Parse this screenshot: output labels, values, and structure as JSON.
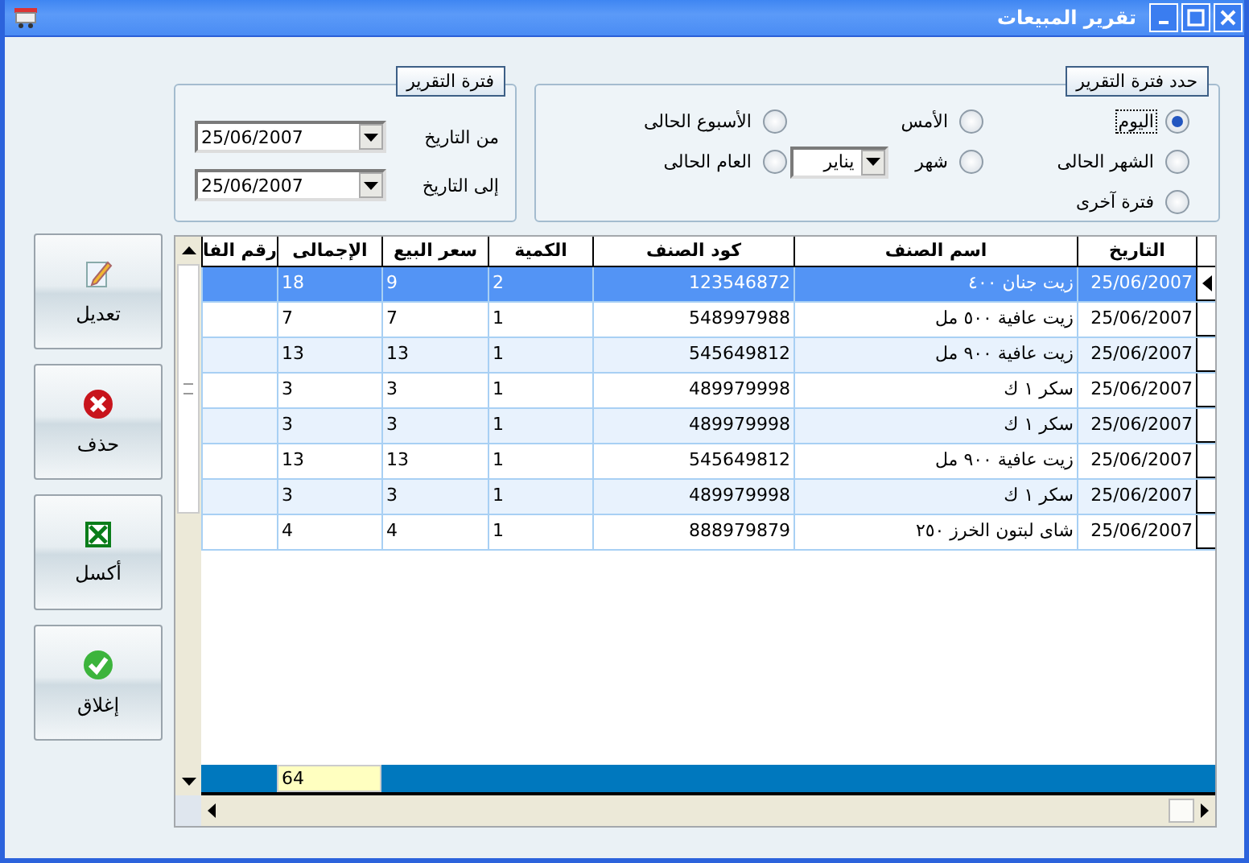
{
  "window": {
    "title": "تقرير المبيعات"
  },
  "date_group": {
    "title": "فترة التقرير",
    "fields": [
      {
        "label": "من التاريخ",
        "value": "25/06/2007"
      },
      {
        "label": "إلى التاريخ",
        "value": "25/06/2007"
      }
    ]
  },
  "period_group": {
    "title": "حدد فترة التقرير",
    "options": [
      {
        "label": "اليوم",
        "selected": true
      },
      {
        "label": "الأمس",
        "selected": false
      },
      {
        "label": "الأسبوع الحالى",
        "selected": false
      },
      {
        "label": "الشهر الحالى",
        "selected": false
      },
      {
        "label": "شهر",
        "selected": false,
        "dropdown": "يناير"
      },
      {
        "label": "العام الحالى",
        "selected": false
      },
      {
        "label": "فترة آخرى",
        "selected": false
      }
    ]
  },
  "actions": [
    {
      "label": "تعديل",
      "kind": "edit"
    },
    {
      "label": "حذف",
      "kind": "delete"
    },
    {
      "label": "أكسل",
      "kind": "excel"
    },
    {
      "label": "إغلاق",
      "kind": "close"
    }
  ],
  "table": {
    "columns": [
      "التاريخ",
      "اسم الصنف",
      "كود الصنف",
      "الكمية",
      "سعر البيع",
      "الإجمالى",
      "رقم الفا"
    ],
    "rows": [
      {
        "selected": true,
        "cells": [
          "25/06/2007",
          "زيت جنان ٤٠٠",
          "123546872",
          "2",
          "9",
          "18"
        ]
      },
      {
        "selected": false,
        "cells": [
          "25/06/2007",
          "زيت عافية ٥٠٠ مل",
          "548997988",
          "1",
          "7",
          "7"
        ]
      },
      {
        "selected": false,
        "cells": [
          "25/06/2007",
          "زيت عافية ٩٠٠ مل",
          "545649812",
          "1",
          "13",
          "13"
        ]
      },
      {
        "selected": false,
        "cells": [
          "25/06/2007",
          "سكر ١ ك",
          "489979998",
          "1",
          "3",
          "3"
        ]
      },
      {
        "selected": false,
        "cells": [
          "25/06/2007",
          "سكر ١ ك",
          "489979998",
          "1",
          "3",
          "3"
        ]
      },
      {
        "selected": false,
        "cells": [
          "25/06/2007",
          "زيت عافية ٩٠٠ مل",
          "545649812",
          "1",
          "13",
          "13"
        ]
      },
      {
        "selected": false,
        "cells": [
          "25/06/2007",
          "سكر ١ ك",
          "489979998",
          "1",
          "3",
          "3"
        ]
      },
      {
        "selected": false,
        "cells": [
          "25/06/2007",
          "شاى لبتون الخرز ٢٥٠",
          "888979879",
          "1",
          "4",
          "4"
        ]
      }
    ],
    "total": "64"
  }
}
